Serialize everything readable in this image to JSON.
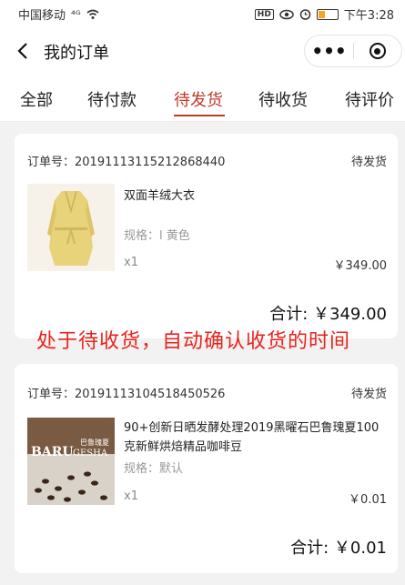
{
  "status_bar": {
    "carrier": "中国移动",
    "signal": "⁴ᴳ",
    "hd": "HD",
    "time": "下午3:28"
  },
  "nav": {
    "title": "我的订单",
    "more": "•••"
  },
  "tabs": [
    {
      "label": "全部"
    },
    {
      "label": "待付款"
    },
    {
      "label": "待发货"
    },
    {
      "label": "待收货"
    },
    {
      "label": "待评价"
    }
  ],
  "active_tab": "待发货",
  "orders": [
    {
      "order_no": "订单号：20191113115212868440",
      "status": "待发货",
      "title": "双面羊绒大衣",
      "spec": "规格：l 黄色",
      "qty": "x1",
      "price": "￥349.00",
      "total": "合计: ￥349.00"
    },
    {
      "order_no": "订单号：20191113104518450526",
      "status": "待发货",
      "title": "90+创新日晒发酵处理2019黑曜石巴鲁瑰夏100克新鲜烘焙精品咖啡豆",
      "spec": "规格：默认",
      "qty": "x1",
      "price": "￥0.01",
      "total": "合计: ￥0.01"
    }
  ],
  "annotation": "处于待收货，自动确认收货的时间",
  "coffee_image_text": {
    "brand": "BARU",
    "sub": "GESHA",
    "cn": "巴鲁瑰夏"
  },
  "colors": {
    "accent": "#c0392b",
    "annotation": "#e8231d",
    "background": "#f2f2f2"
  }
}
